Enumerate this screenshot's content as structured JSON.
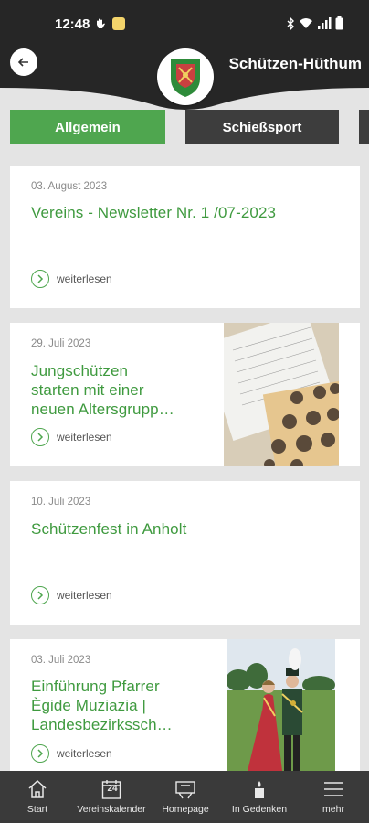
{
  "status_bar": {
    "time": "12:48"
  },
  "header": {
    "title": "Schützen-Hüthum",
    "back_icon": "arrow-left-icon",
    "logo": "club-crest-logo"
  },
  "tabs": [
    {
      "label": "Allgemein",
      "active": true
    },
    {
      "label": "Schießsport",
      "active": false
    }
  ],
  "articles": [
    {
      "date": "03. August 2023",
      "title_lines": [
        "Vereins - Newsletter Nr. 1 /07-2023"
      ],
      "more": "weiterlesen",
      "has_image": false
    },
    {
      "date": "29. Juli 2023",
      "title_lines": [
        "Jungschützen",
        "starten mit einer",
        "neuen Altersgrupp…"
      ],
      "more": "weiterlesen",
      "has_image": true,
      "image": "shooting-targets-photo"
    },
    {
      "date": "10. Juli 2023",
      "title_lines": [
        "Schützenfest in Anholt"
      ],
      "more": "weiterlesen",
      "has_image": false
    },
    {
      "date": "03. Juli 2023",
      "title_lines": [
        "Einführung Pfarrer",
        "Ègide Muziazia |",
        "Landesbezirkssch…"
      ],
      "more": "weiterlesen",
      "has_image": true,
      "image": "royal-couple-photo"
    }
  ],
  "bottom_nav": [
    {
      "label": "Start",
      "icon": "home-icon"
    },
    {
      "label": "Vereinskalender",
      "icon": "calendar-icon",
      "icon_text": "24"
    },
    {
      "label": "Homepage",
      "icon": "homepage-icon"
    },
    {
      "label": "In Gedenken",
      "icon": "candle-icon"
    },
    {
      "label": "mehr",
      "icon": "menu-icon"
    }
  ],
  "colors": {
    "accent_green": "#4fa64f",
    "title_green": "#3f9a3f",
    "dark": "#262626",
    "tab_inactive": "#3d3d3d",
    "nav_bg": "#3a3a3a",
    "background": "#e4e4e4"
  }
}
